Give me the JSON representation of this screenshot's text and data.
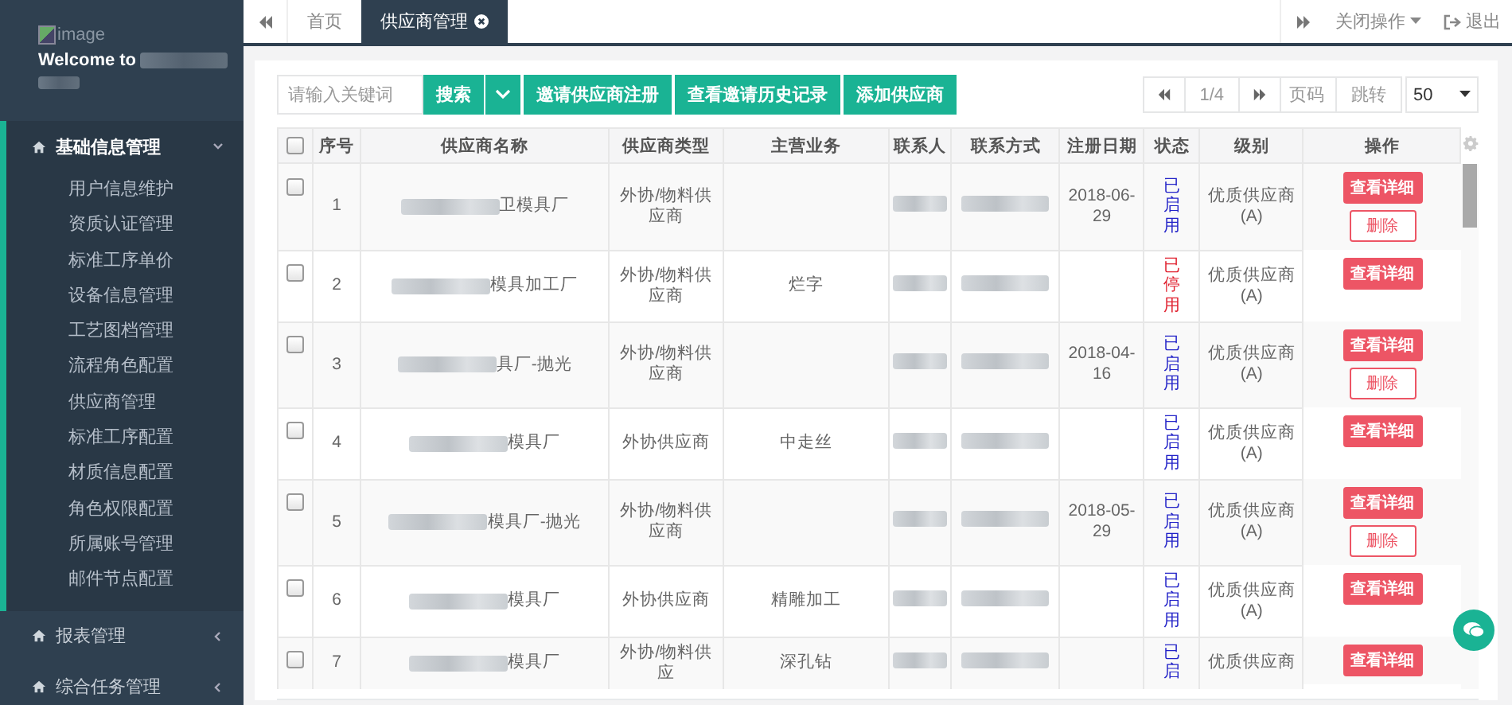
{
  "sidebar": {
    "logo_alt": "image",
    "welcome": "Welcome to",
    "menus": [
      {
        "label": "基础信息管理",
        "expanded": true,
        "children": [
          {
            "label": "用户信息维护"
          },
          {
            "label": "资质认证管理"
          },
          {
            "label": "标准工序单价"
          },
          {
            "label": "设备信息管理"
          },
          {
            "label": "工艺图档管理"
          },
          {
            "label": "流程角色配置"
          },
          {
            "label": "供应商管理"
          },
          {
            "label": "标准工序配置"
          },
          {
            "label": "材质信息配置"
          },
          {
            "label": "角色权限配置"
          },
          {
            "label": "所属账号管理"
          },
          {
            "label": "邮件节点配置"
          }
        ]
      },
      {
        "label": "报表管理",
        "expanded": false
      },
      {
        "label": "综合任务管理",
        "expanded": false
      }
    ]
  },
  "tabs": [
    {
      "label": "首页",
      "selected": false,
      "closable": false
    },
    {
      "label": "供应商管理",
      "selected": true,
      "closable": true
    }
  ],
  "top_actions": {
    "close_menu": "关闭操作",
    "logout": "退出"
  },
  "toolbar": {
    "search_placeholder": "请输入关键词",
    "search_button": "搜索",
    "buttons": [
      "邀请供应商注册",
      "查看邀请历史记录",
      "添加供应商"
    ]
  },
  "pager": {
    "page": "1/4",
    "page_placeholder": "页码",
    "jump": "跳转",
    "page_size": "50"
  },
  "table": {
    "header_checked": false,
    "columns": [
      "序号",
      "供应商名称",
      "供应商类型",
      "主营业务",
      "联系人",
      "联系方式",
      "注册日期",
      "状态",
      "级别",
      "操作"
    ],
    "rows": [
      {
        "checked": false,
        "no": "1",
        "name": "卫模具厂",
        "type": "外协/物料供应商",
        "business": "",
        "date": "2018-06-29",
        "status": "已启用",
        "enabled": true,
        "level": "优质供应商(A)",
        "actions": [
          {
            "label": "查看详细",
            "kind": "primary"
          },
          {
            "label": "删除",
            "kind": "outline"
          }
        ]
      },
      {
        "checked": false,
        "no": "2",
        "name": "模具加工厂",
        "type": "外协/物料供应商",
        "business": "烂字",
        "date": "",
        "status": "已停用",
        "enabled": false,
        "level": "优质供应商(A)",
        "actions": [
          {
            "label": "查看详细",
            "kind": "primary"
          }
        ]
      },
      {
        "checked": false,
        "no": "3",
        "name": "具厂-抛光",
        "type": "外协/物料供应商",
        "business": "",
        "date": "2018-04-16",
        "status": "已启用",
        "enabled": true,
        "level": "优质供应商(A)",
        "actions": [
          {
            "label": "查看详细",
            "kind": "primary"
          },
          {
            "label": "删除",
            "kind": "outline"
          }
        ]
      },
      {
        "checked": false,
        "no": "4",
        "name": "模具厂",
        "type": "外协供应商",
        "business": "中走丝",
        "date": "",
        "status": "已启用",
        "enabled": true,
        "level": "优质供应商(A)",
        "actions": [
          {
            "label": "查看详细",
            "kind": "primary"
          }
        ]
      },
      {
        "checked": false,
        "no": "5",
        "name": "模具厂-抛光",
        "type": "外协/物料供应商",
        "business": "",
        "date": "2018-05-29",
        "status": "已启用",
        "enabled": true,
        "level": "优质供应商(A)",
        "actions": [
          {
            "label": "查看详细",
            "kind": "primary"
          },
          {
            "label": "删除",
            "kind": "outline"
          }
        ]
      },
      {
        "checked": false,
        "no": "6",
        "name": "模具厂",
        "type": "外协供应商",
        "business": "精雕加工",
        "date": "",
        "status": "已启用",
        "enabled": true,
        "level": "优质供应商(A)",
        "actions": [
          {
            "label": "查看详细",
            "kind": "primary"
          }
        ]
      },
      {
        "checked": false,
        "no": "7",
        "name": "模具厂",
        "type": "外协/物料供应",
        "business": "深孔钻",
        "date": "",
        "status": "已启",
        "enabled": true,
        "level": "优质供应商",
        "actions": [
          {
            "label": "查看详细",
            "kind": "primary"
          }
        ]
      }
    ]
  }
}
